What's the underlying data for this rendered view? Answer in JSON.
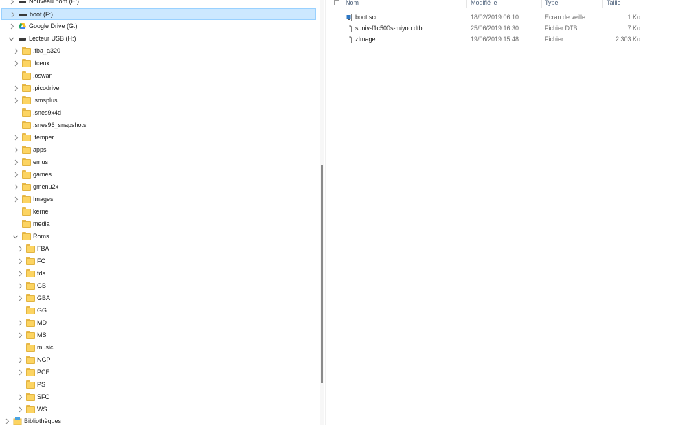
{
  "nav_tree": [
    {
      "label": "Nouveau nom (E:)",
      "icon": "drive-icon",
      "expandable": true,
      "expanded": false
    },
    {
      "label": "boot (F:)",
      "icon": "drive-icon",
      "expandable": true,
      "expanded": false,
      "selected": true
    },
    {
      "label": "Google Drive (G:)",
      "icon": "google-drive-icon",
      "expandable": true,
      "expanded": false
    },
    {
      "label": "Lecteur USB (H:)",
      "icon": "drive-icon",
      "expandable": true,
      "expanded": true
    },
    {
      "label": ".fba_a320",
      "icon": "folder-icon",
      "expandable": true,
      "expanded": false
    },
    {
      "label": ".fceux",
      "icon": "folder-icon",
      "expandable": true,
      "expanded": false
    },
    {
      "label": ".oswan",
      "icon": "folder-icon",
      "expandable": false
    },
    {
      "label": ".picodrive",
      "icon": "folder-icon",
      "expandable": true,
      "expanded": false
    },
    {
      "label": ".smsplus",
      "icon": "folder-icon",
      "expandable": true,
      "expanded": false
    },
    {
      "label": ".snes9x4d",
      "icon": "folder-icon",
      "expandable": false
    },
    {
      "label": ".snes96_snapshots",
      "icon": "folder-icon",
      "expandable": false
    },
    {
      "label": ".temper",
      "icon": "folder-icon",
      "expandable": true,
      "expanded": false
    },
    {
      "label": "apps",
      "icon": "folder-icon",
      "expandable": true,
      "expanded": false
    },
    {
      "label": "emus",
      "icon": "folder-icon",
      "expandable": true,
      "expanded": false
    },
    {
      "label": "games",
      "icon": "folder-icon",
      "expandable": true,
      "expanded": false
    },
    {
      "label": "gmenu2x",
      "icon": "folder-icon",
      "expandable": true,
      "expanded": false
    },
    {
      "label": "Images",
      "icon": "folder-icon",
      "expandable": true,
      "expanded": false
    },
    {
      "label": "kernel",
      "icon": "folder-icon",
      "expandable": false
    },
    {
      "label": "media",
      "icon": "folder-icon",
      "expandable": false
    },
    {
      "label": "Roms",
      "icon": "folder-icon",
      "expandable": true,
      "expanded": true
    },
    {
      "label": "FBA",
      "icon": "folder-icon",
      "expandable": true,
      "expanded": false
    },
    {
      "label": "FC",
      "icon": "folder-icon",
      "expandable": true,
      "expanded": false
    },
    {
      "label": "fds",
      "icon": "folder-icon",
      "expandable": true,
      "expanded": false
    },
    {
      "label": "GB",
      "icon": "folder-icon",
      "expandable": true,
      "expanded": false
    },
    {
      "label": "GBA",
      "icon": "folder-icon",
      "expandable": true,
      "expanded": false
    },
    {
      "label": "GG",
      "icon": "folder-icon",
      "expandable": false
    },
    {
      "label": "MD",
      "icon": "folder-icon",
      "expandable": true,
      "expanded": false
    },
    {
      "label": "MS",
      "icon": "folder-icon",
      "expandable": true,
      "expanded": false
    },
    {
      "label": "music",
      "icon": "folder-icon",
      "expandable": false
    },
    {
      "label": "NGP",
      "icon": "folder-icon",
      "expandable": true,
      "expanded": false
    },
    {
      "label": "PCE",
      "icon": "folder-icon",
      "expandable": true,
      "expanded": false
    },
    {
      "label": "PS",
      "icon": "folder-icon",
      "expandable": false
    },
    {
      "label": "SFC",
      "icon": "folder-icon",
      "expandable": true,
      "expanded": false
    },
    {
      "label": "WS",
      "icon": "folder-icon",
      "expandable": true,
      "expanded": false
    },
    {
      "label": "Bibliothèques",
      "icon": "library-icon",
      "expandable": true,
      "expanded": false
    }
  ],
  "file_list": {
    "columns": {
      "name": "Nom",
      "modified": "Modifié le",
      "type": "Type",
      "size": "Taille"
    },
    "rows": [
      {
        "name": "boot.scr",
        "modified": "18/02/2019 06:10",
        "type": "Écran de veille",
        "size": "1 Ko",
        "icon": "screensaver-file-icon"
      },
      {
        "name": "suniv-f1c500s-miyoo.dtb",
        "modified": "25/06/2019 16:30",
        "type": "Fichier DTB",
        "size": "7 Ko",
        "icon": "generic-file-icon"
      },
      {
        "name": "zImage",
        "modified": "19/06/2019 15:48",
        "type": "Fichier",
        "size": "2 303 Ko",
        "icon": "generic-file-icon"
      }
    ]
  },
  "colors": {
    "selection_bg": "#cce8ff",
    "selection_border": "#99d1ff",
    "folder": "#fcd462",
    "header_text": "#4c607a"
  }
}
